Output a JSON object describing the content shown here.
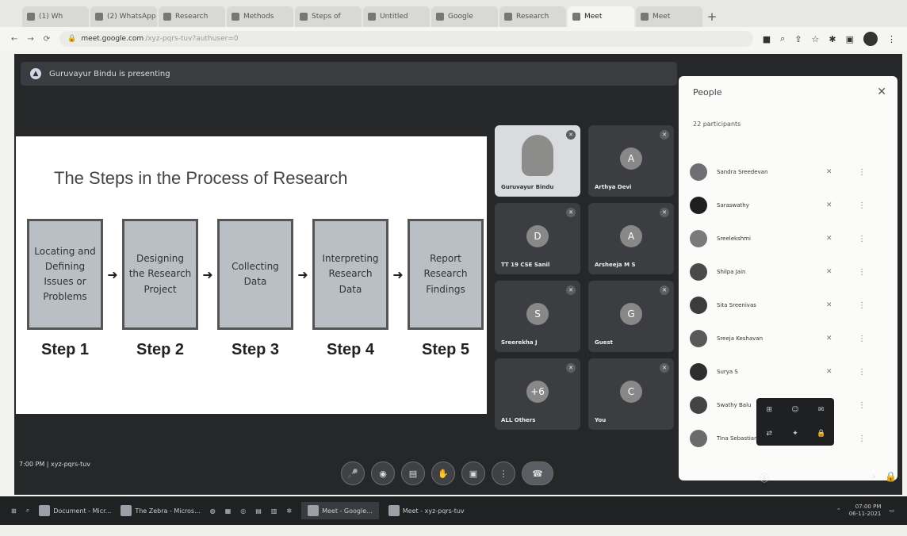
{
  "browser": {
    "tabs": [
      {
        "label": "(1) Wh"
      },
      {
        "label": "(2) WhatsApp"
      },
      {
        "label": "Research"
      },
      {
        "label": "Methods"
      },
      {
        "label": "Steps of"
      },
      {
        "label": "Untitled"
      },
      {
        "label": "Google"
      },
      {
        "label": "Research"
      },
      {
        "label": "Meet",
        "active": true
      },
      {
        "label": "Meet"
      }
    ],
    "url": "meet.google.com",
    "url_path": "/xyz-pqrs-tuv?authuser=0"
  },
  "meet": {
    "presenting_banner": "Guruvayur Bindu is presenting",
    "slide": {
      "title": "The Steps in the Process of Research",
      "steps": [
        {
          "text": "Locating and Defining Issues or Problems",
          "label": "Step 1"
        },
        {
          "text": "Designing the Research Project",
          "label": "Step 2"
        },
        {
          "text": "Collecting Data",
          "label": "Step 3"
        },
        {
          "text": "Interpreting Research Data",
          "label": "Step 4"
        },
        {
          "text": "Report Research Findings",
          "label": "Step 5"
        }
      ]
    },
    "tiles": [
      {
        "name": "Guruvayur Bindu",
        "avatar": "",
        "video": true
      },
      {
        "name": "Arthya Devi",
        "avatar": "A"
      },
      {
        "name": "TT 19 CSE Sanil",
        "avatar": "D"
      },
      {
        "name": "Arsheeja M S",
        "avatar": "A"
      },
      {
        "name": "Sreerekha J",
        "avatar": "S"
      },
      {
        "name": "Guest",
        "avatar": "G"
      },
      {
        "name": "ALL Others",
        "avatar": "+6"
      },
      {
        "name": "You",
        "avatar": "C"
      }
    ],
    "people_panel": {
      "title": "People",
      "count": "22 participants",
      "participants": [
        {
          "name": "Sandra Sreedevan",
          "color": "#6d6f73"
        },
        {
          "name": "Saraswathy",
          "color": "#1f1f1f"
        },
        {
          "name": "Sreelekshmi",
          "color": "#7a7a7a"
        },
        {
          "name": "Shilpa Jain",
          "color": "#4a4a4a"
        },
        {
          "name": "Sita Sreenivas",
          "color": "#3c3c3c"
        },
        {
          "name": "Sreeja Keshavan",
          "color": "#595959"
        },
        {
          "name": "Surya S",
          "color": "#2e2e2e"
        },
        {
          "name": "Swathy Balu",
          "color": "#444444"
        },
        {
          "name": "Tina Sebastian",
          "color": "#6b6b6b"
        }
      ]
    },
    "clock": "7:00 PM | xyz-pqrs-tuv",
    "controls": [
      "mic",
      "camera",
      "captions",
      "raise-hand",
      "present",
      "more",
      "end-call"
    ]
  },
  "taskbar": {
    "items": [
      "Document - Micr...",
      "The Zebra - Micros...",
      "Meet - Google...",
      "Meet - xyz-pqrs-tuv"
    ],
    "time": "07:00 PM",
    "date": "06-11-2021"
  }
}
